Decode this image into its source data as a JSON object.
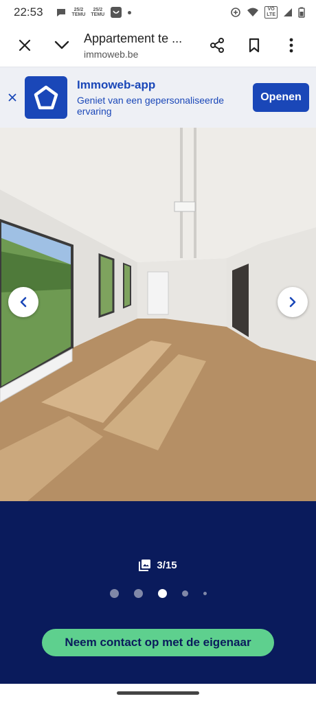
{
  "status_bar": {
    "time": "22:53",
    "notif_1": "25/2 TEMU",
    "notif_1_top": "25/2",
    "notif_1_bottom": "TEMU",
    "notif_2_top": "25/2",
    "notif_2_bottom": "TEMU",
    "lte_top": "VO",
    "lte_bottom": "LTE"
  },
  "browser": {
    "title": "Appartement te ...",
    "url": "immoweb.be"
  },
  "app_banner": {
    "title": "Immoweb-app",
    "subtitle": "Geniet van een gepersonaliseerde ervaring",
    "open_label": "Openen"
  },
  "gallery": {
    "counter": "3/15",
    "current_index": 3,
    "total": 15,
    "contact_label": "Neem contact op met de eigenaar"
  },
  "colors": {
    "brand_blue": "#1a47b8",
    "gallery_bg": "#0a1b5c",
    "cta_green": "#5ed08e"
  }
}
